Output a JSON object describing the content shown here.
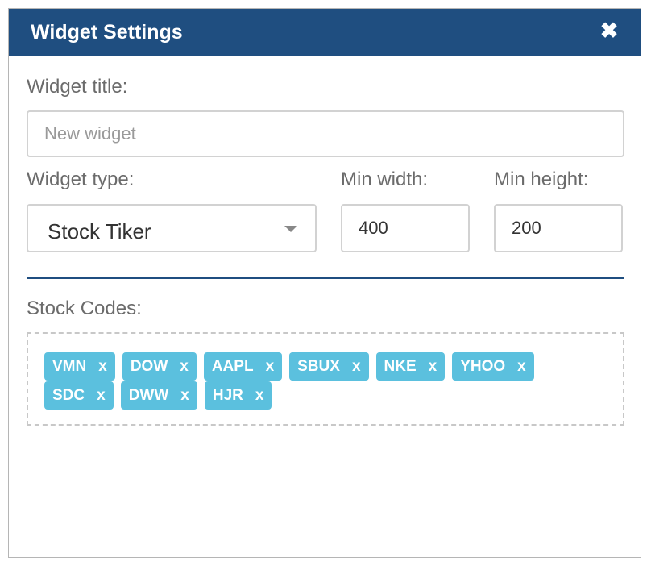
{
  "dialog": {
    "title": "Widget Settings",
    "close_glyph": "✖"
  },
  "form": {
    "title_label": "Widget title:",
    "title_placeholder": "New widget",
    "title_value": "",
    "type_label": "Widget type:",
    "type_value": "Stock Tiker",
    "min_width_label": "Min width:",
    "min_width_value": "400",
    "min_height_label": "Min height:",
    "min_height_value": "200",
    "stock_codes_label": "Stock Codes:"
  },
  "stock_codes": [
    {
      "code": "VMN",
      "remove": "x"
    },
    {
      "code": "DOW",
      "remove": "x"
    },
    {
      "code": "AAPL",
      "remove": "x"
    },
    {
      "code": "SBUX",
      "remove": "x"
    },
    {
      "code": "NKE",
      "remove": "x"
    },
    {
      "code": "YHOO",
      "remove": "x"
    },
    {
      "code": "SDC",
      "remove": "x"
    },
    {
      "code": "DWW",
      "remove": "x"
    },
    {
      "code": "HJR",
      "remove": "x"
    }
  ],
  "colors": {
    "header_bg": "#1f4e80",
    "tag_bg": "#5bc0de",
    "divider": "#1f4e80"
  },
  "icons": {
    "close": "close-icon",
    "dropdown": "caret-down-icon"
  }
}
